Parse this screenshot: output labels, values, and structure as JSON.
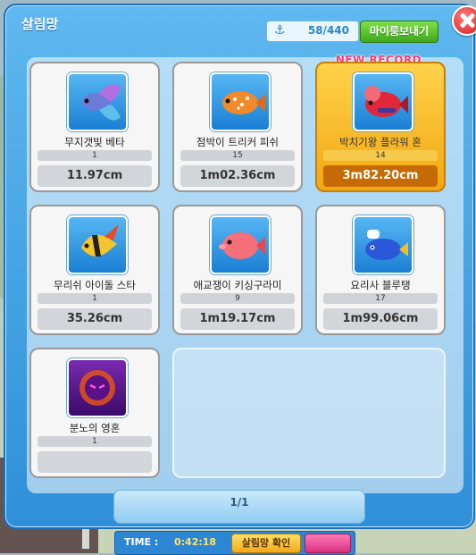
{
  "window": {
    "title": "살림망",
    "catch_count": "58/440",
    "send_button": "마이룸보내기"
  },
  "new_record_label": "NEW RECORD",
  "fish": [
    {
      "name": "무지갯빛 베타",
      "count": "1",
      "size": "11.97cm",
      "icon": "rainbow-betta-icon",
      "record": false
    },
    {
      "name": "점박이 트리커 피쉬",
      "count": "15",
      "size": "1m02.36cm",
      "icon": "spotted-triggerfish-icon",
      "record": false
    },
    {
      "name": "박치기왕 플라워 혼",
      "count": "14",
      "size": "3m82.20cm",
      "icon": "flowerhorn-icon",
      "record": true
    },
    {
      "name": "무리쉬 아이돌 스타",
      "count": "1",
      "size": "35.26cm",
      "icon": "moorish-idol-icon",
      "record": false
    },
    {
      "name": "애교쟁이 키싱구라미",
      "count": "9",
      "size": "1m19.17cm",
      "icon": "kissing-gourami-icon",
      "record": false
    },
    {
      "name": "요리사 블루탱",
      "count": "17",
      "size": "1m99.06cm",
      "icon": "chef-blue-tang-icon",
      "record": false
    },
    {
      "name": "분노의 영혼",
      "count": "1",
      "size": "",
      "icon": "angry-spirit-icon",
      "record": false
    }
  ],
  "pager": {
    "text": "1/1"
  },
  "bottom_bar": {
    "time_label": "TIME :",
    "time_value": "0:42:18",
    "confirm_button": "살림망 확인"
  },
  "colors": {
    "panel_blue": "#2f8fd8",
    "record_gold": "#f2a812",
    "record_size_bg": "#c56a05",
    "send_green": "#3fa81c",
    "close_red": "#d41e1e"
  }
}
